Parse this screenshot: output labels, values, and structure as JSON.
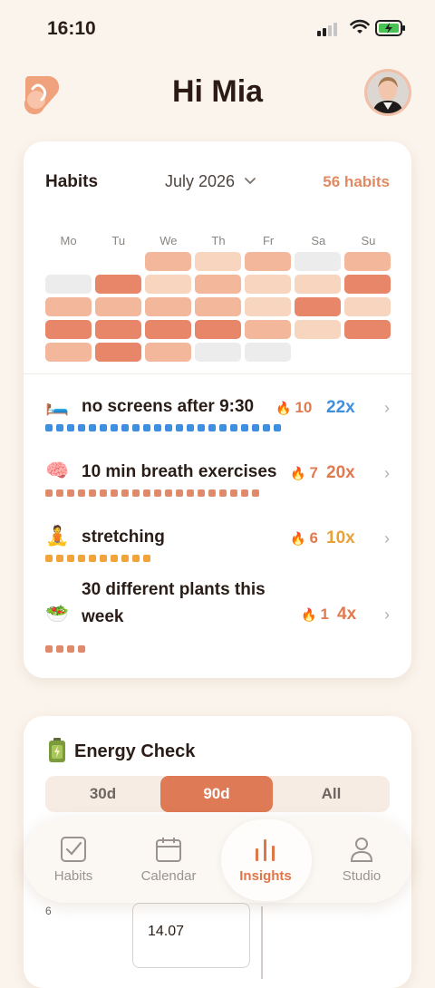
{
  "status_bar": {
    "time": "16:10"
  },
  "header": {
    "title": "Hi Mia"
  },
  "habits_card": {
    "title": "Habits",
    "month": "July 2026",
    "count": "56 habits",
    "weekdays": [
      "Mo",
      "Tu",
      "We",
      "Th",
      "Fr",
      "Sa",
      "Su"
    ],
    "calendar_cells": [
      "none",
      "none",
      "#f3b79c",
      "#f8d5be",
      "#f3b79c",
      "#ececec",
      "#f3b79c",
      "#ececec",
      "#e8866a",
      "#f8d5be",
      "#f3b79c",
      "#f8d5be",
      "#f8d5be",
      "#e8866a",
      "#f3b79c",
      "#f3b79c",
      "#f3b79c",
      "#f3b79c",
      "#f8d5be",
      "#e8866a",
      "#f8d5be",
      "#e8866a",
      "#e8866a",
      "#e8866a",
      "#e8866a",
      "#f3b79c",
      "#f8d5be",
      "#e8866a",
      "#f3b79c",
      "#e8866a",
      "#f3b79c",
      "#ececec",
      "#ececec",
      "none",
      "none"
    ],
    "habits": [
      {
        "emoji": "🛏️",
        "name": "no screens after 9:30",
        "streak": "10",
        "times": "22x",
        "times_color": "#3f8fe0",
        "dot_color": "#3f8fe0",
        "dots": 22
      },
      {
        "emoji": "🧠",
        "name": "10 min breath exercises",
        "streak": "7",
        "times": "20x",
        "times_color": "#e07a4f",
        "dot_color": "#e08a6c",
        "dots": 20
      },
      {
        "emoji": "🧘",
        "name": "stretching",
        "streak": "6",
        "times": "10x",
        "times_color": "#e8a23a",
        "dot_color": "#f0a43a",
        "dots": 10
      },
      {
        "emoji": "🥗",
        "name": "30 different plants this week",
        "streak": "1",
        "times": "4x",
        "times_color": "#e07a4f",
        "dot_color": "#e08a6c",
        "dots": 4
      }
    ]
  },
  "energy_card": {
    "title": "Energy Check",
    "ranges": [
      "30d",
      "90d",
      "All"
    ],
    "selected_range": "90d",
    "y_label": "6",
    "tooltip_date": "14.07"
  },
  "tabbar": {
    "tabs": [
      {
        "label": "Habits",
        "icon": "checkbox-icon"
      },
      {
        "label": "Calendar",
        "icon": "calendar-icon"
      },
      {
        "label": "Insights",
        "icon": "bar-chart-icon"
      },
      {
        "label": "Studio",
        "icon": "person-icon"
      }
    ],
    "active": "Insights"
  }
}
